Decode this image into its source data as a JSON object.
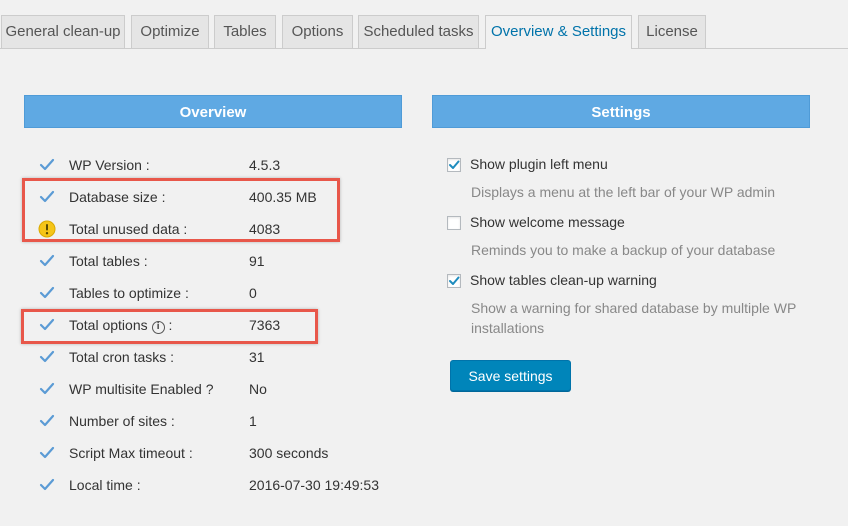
{
  "tabs": [
    {
      "label": "General clean-up",
      "active": false
    },
    {
      "label": "Optimize",
      "active": false
    },
    {
      "label": "Tables",
      "active": false
    },
    {
      "label": "Options",
      "active": false
    },
    {
      "label": "Scheduled tasks",
      "active": false
    },
    {
      "label": "Overview & Settings",
      "active": true
    },
    {
      "label": "License",
      "active": false
    }
  ],
  "overview": {
    "header": "Overview",
    "rows": [
      {
        "label": "WP Version :",
        "value": "4.5.3",
        "icon": "check-icon"
      },
      {
        "label": "Database size :",
        "value": "400.35 MB",
        "icon": "check-icon"
      },
      {
        "label": "Total unused data :",
        "value": "4083",
        "icon": "warning-icon"
      },
      {
        "label": "Total tables :",
        "value": "91",
        "icon": "check-icon"
      },
      {
        "label": "Tables to optimize :",
        "value": "0",
        "icon": "check-icon"
      },
      {
        "label": "Total options",
        "label_suffix": ":",
        "value": "7363",
        "icon": "check-icon"
      },
      {
        "label": "Total cron tasks :",
        "value": "31",
        "icon": "check-icon"
      },
      {
        "label": "WP multisite Enabled ?",
        "value": "No",
        "icon": "check-icon"
      },
      {
        "label": "Number of sites :",
        "value": "1",
        "icon": "check-icon"
      },
      {
        "label": "Script Max timeout :",
        "value": "300 seconds",
        "icon": "check-icon"
      },
      {
        "label": "Local time :",
        "value": "2016-07-30 19:49:53",
        "icon": "check-icon"
      }
    ]
  },
  "settings": {
    "header": "Settings",
    "items": [
      {
        "title": "Show plugin left menu",
        "desc": "Displays a menu at the left bar of your WP admin",
        "checked": true
      },
      {
        "title": "Show welcome message",
        "desc": "Reminds you to make a backup of your database",
        "checked": false
      },
      {
        "title": "Show tables clean-up warning",
        "desc": "Show a warning for shared database by multiple WP installations",
        "checked": true
      }
    ],
    "save_label": "Save settings"
  },
  "colors": {
    "accent": "#0073aa",
    "header_bg": "#5fa9e3",
    "highlight": "#e8574a",
    "check": "#5b9bd5",
    "warning": "#f5c518"
  }
}
